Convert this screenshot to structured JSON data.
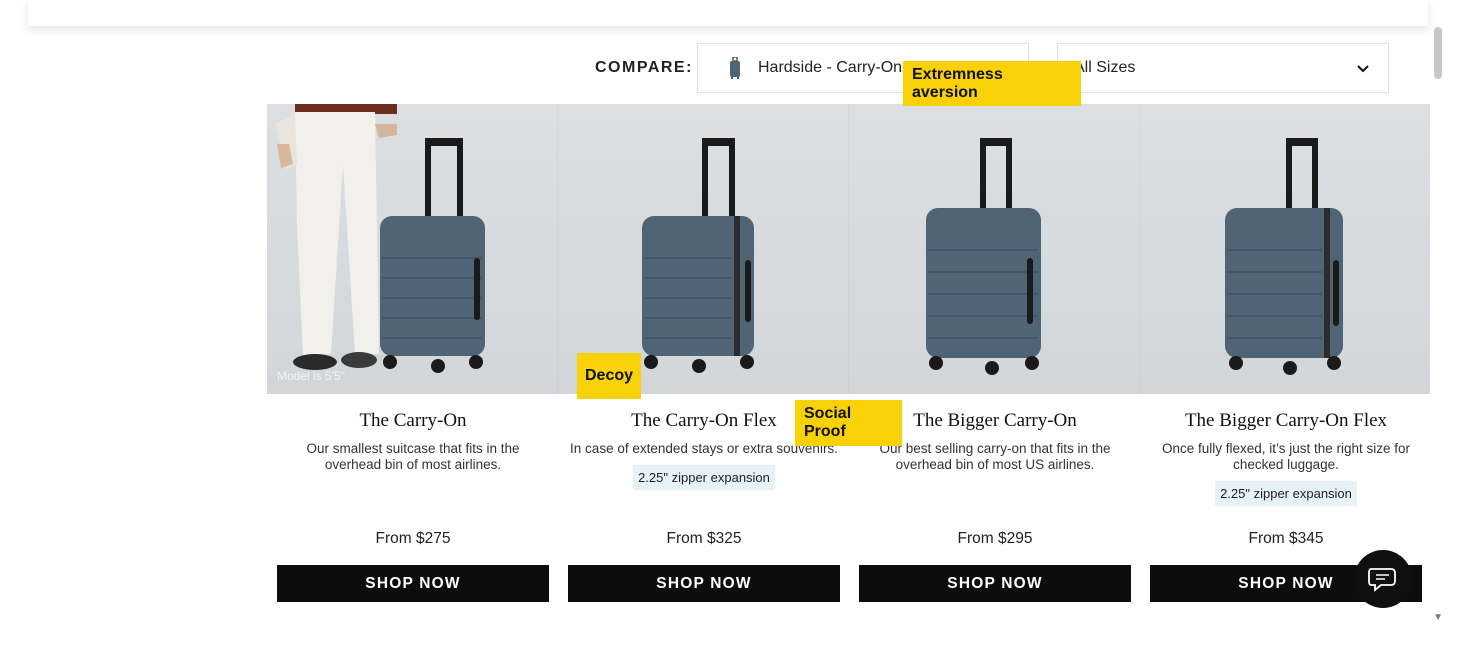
{
  "compare": {
    "label": "COMPARE:",
    "type_value": "Hardside - Carry-Ons",
    "type_icon": "suitcase-icon",
    "size_value": "All Sizes",
    "size_icon": "chevron-down-icon"
  },
  "photo": {
    "model_note": "Model is 5'5\""
  },
  "products": [
    {
      "name": "The Carry-On",
      "desc": "Our smallest suitcase that fits in the overhead bin of most airlines.",
      "tag": "",
      "price": "From $275",
      "cta": "SHOP NOW"
    },
    {
      "name": "The Carry-On Flex",
      "desc": "In case of extended stays or extra souvenirs.",
      "tag": "2.25\" zipper expansion",
      "price": "From $325",
      "cta": "SHOP NOW"
    },
    {
      "name": "The Bigger Carry-On",
      "desc": "Our best selling carry-on that fits in the overhead bin of most US airlines.",
      "tag": "",
      "price": "From $295",
      "cta": "SHOP NOW"
    },
    {
      "name": "The Bigger Carry-On Flex",
      "desc": "Once fully flexed, it’s just the right size for checked luggage.",
      "tag": "2.25\" zipper expansion",
      "price": "From $345",
      "cta": "SHOP NOW"
    }
  ],
  "annotations": {
    "extremeness": "Extremness aversion",
    "decoy": "Decoy",
    "social_proof": "Social Proof"
  },
  "chat": {
    "icon": "chat-bubble-icon"
  },
  "colors": {
    "suitcase": "#4f6475",
    "button": "#0d0d0d",
    "sticker": "#f9d107",
    "tag_bg": "#e6f1f8"
  }
}
